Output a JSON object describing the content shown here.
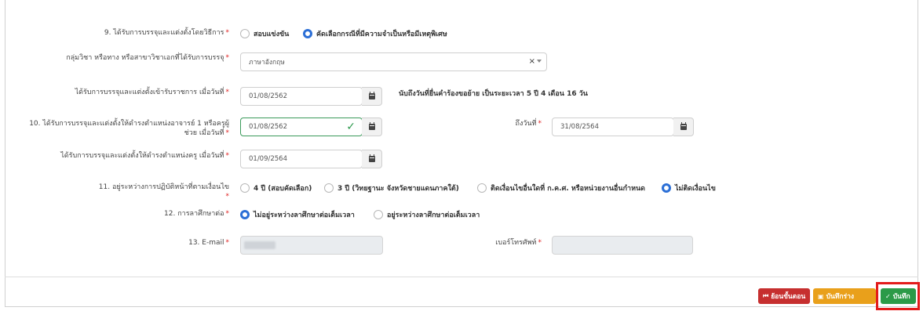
{
  "fields": {
    "q9_label": "9. ได้รับการบรรจุและแต่งตั้งโดยวิธีการ",
    "q9_options": [
      "สอบแข่งขัน",
      "คัดเลือกกรณีที่มีความจำเป็นหรือมีเหตุพิเศษ"
    ],
    "q9_selected": 1,
    "subject_label": "กลุ่มวิชา หรือทาง หรือสาขาวิชาเอกที่ได้รับการบรรจุ",
    "subject_value": "ภาษาอังกฤษ",
    "gov_start_label": "ได้รับการบรรจุและแต่งตั้งเข้ารับราชการ เมื่อวันที่",
    "gov_start_value": "01/08/2562",
    "service_info": "นับถึงวันที่ยื่นคำร้องขอย้าย เป็นระยะเวลา 5 ปี 4 เดือน 16 วัน",
    "q10_label_line1": "10. ได้รับการบรรจุและแต่งตั้งให้ดำรงตำแหน่งอาจารย์ 1 หรือครูผู้",
    "q10_label_line2": "ช่วย เมื่อวันที่",
    "q10_value": "01/08/2562",
    "q10_until_label": "ถึงวันที่",
    "q10_until_value": "31/08/2564",
    "teacher_label": "ได้รับการบรรจุและแต่งตั้งให้ดำรงตำแหน่งครู เมื่อวันที่",
    "teacher_value": "01/09/2564",
    "q11_label": "11. อยู่ระหว่างการปฏิบัติหน้าที่ตามเงื่อนไข",
    "q11_options": [
      "4 ปี (สอบคัดเลือก)",
      "3 ปี (วิทยฐานะ จังหวัดชายแดนภาคใต้)",
      "ติดเงื่อนไขอื่นใดที่ ก.ค.ศ. หรือหน่วยงานอื่นกำหนด",
      "ไม่ติดเงื่อนไข"
    ],
    "q11_selected": 3,
    "q12_label": "12. การลาศึกษาต่อ",
    "q12_options": [
      "ไม่อยู่ระหว่างลาศึกษาต่อเต็มเวลา",
      "อยู่ระหว่างลาศึกษาต่อเต็มเวลา"
    ],
    "q12_selected": 0,
    "email_label": "13. E-mail",
    "phone_label": "เบอร์โทรศัพท์"
  },
  "required_mark": "*",
  "footer": {
    "back_label": "ย้อนขั้นตอน",
    "draft_label": "บันทึกร่าง",
    "save_label": "บันทึก"
  },
  "colors": {
    "accent": "#2c6fd6",
    "valid": "#2e9a4e",
    "back": "#c62f2f",
    "draft": "#e9a01b",
    "save": "#2b9a48",
    "highlight": "#e31b1b"
  }
}
